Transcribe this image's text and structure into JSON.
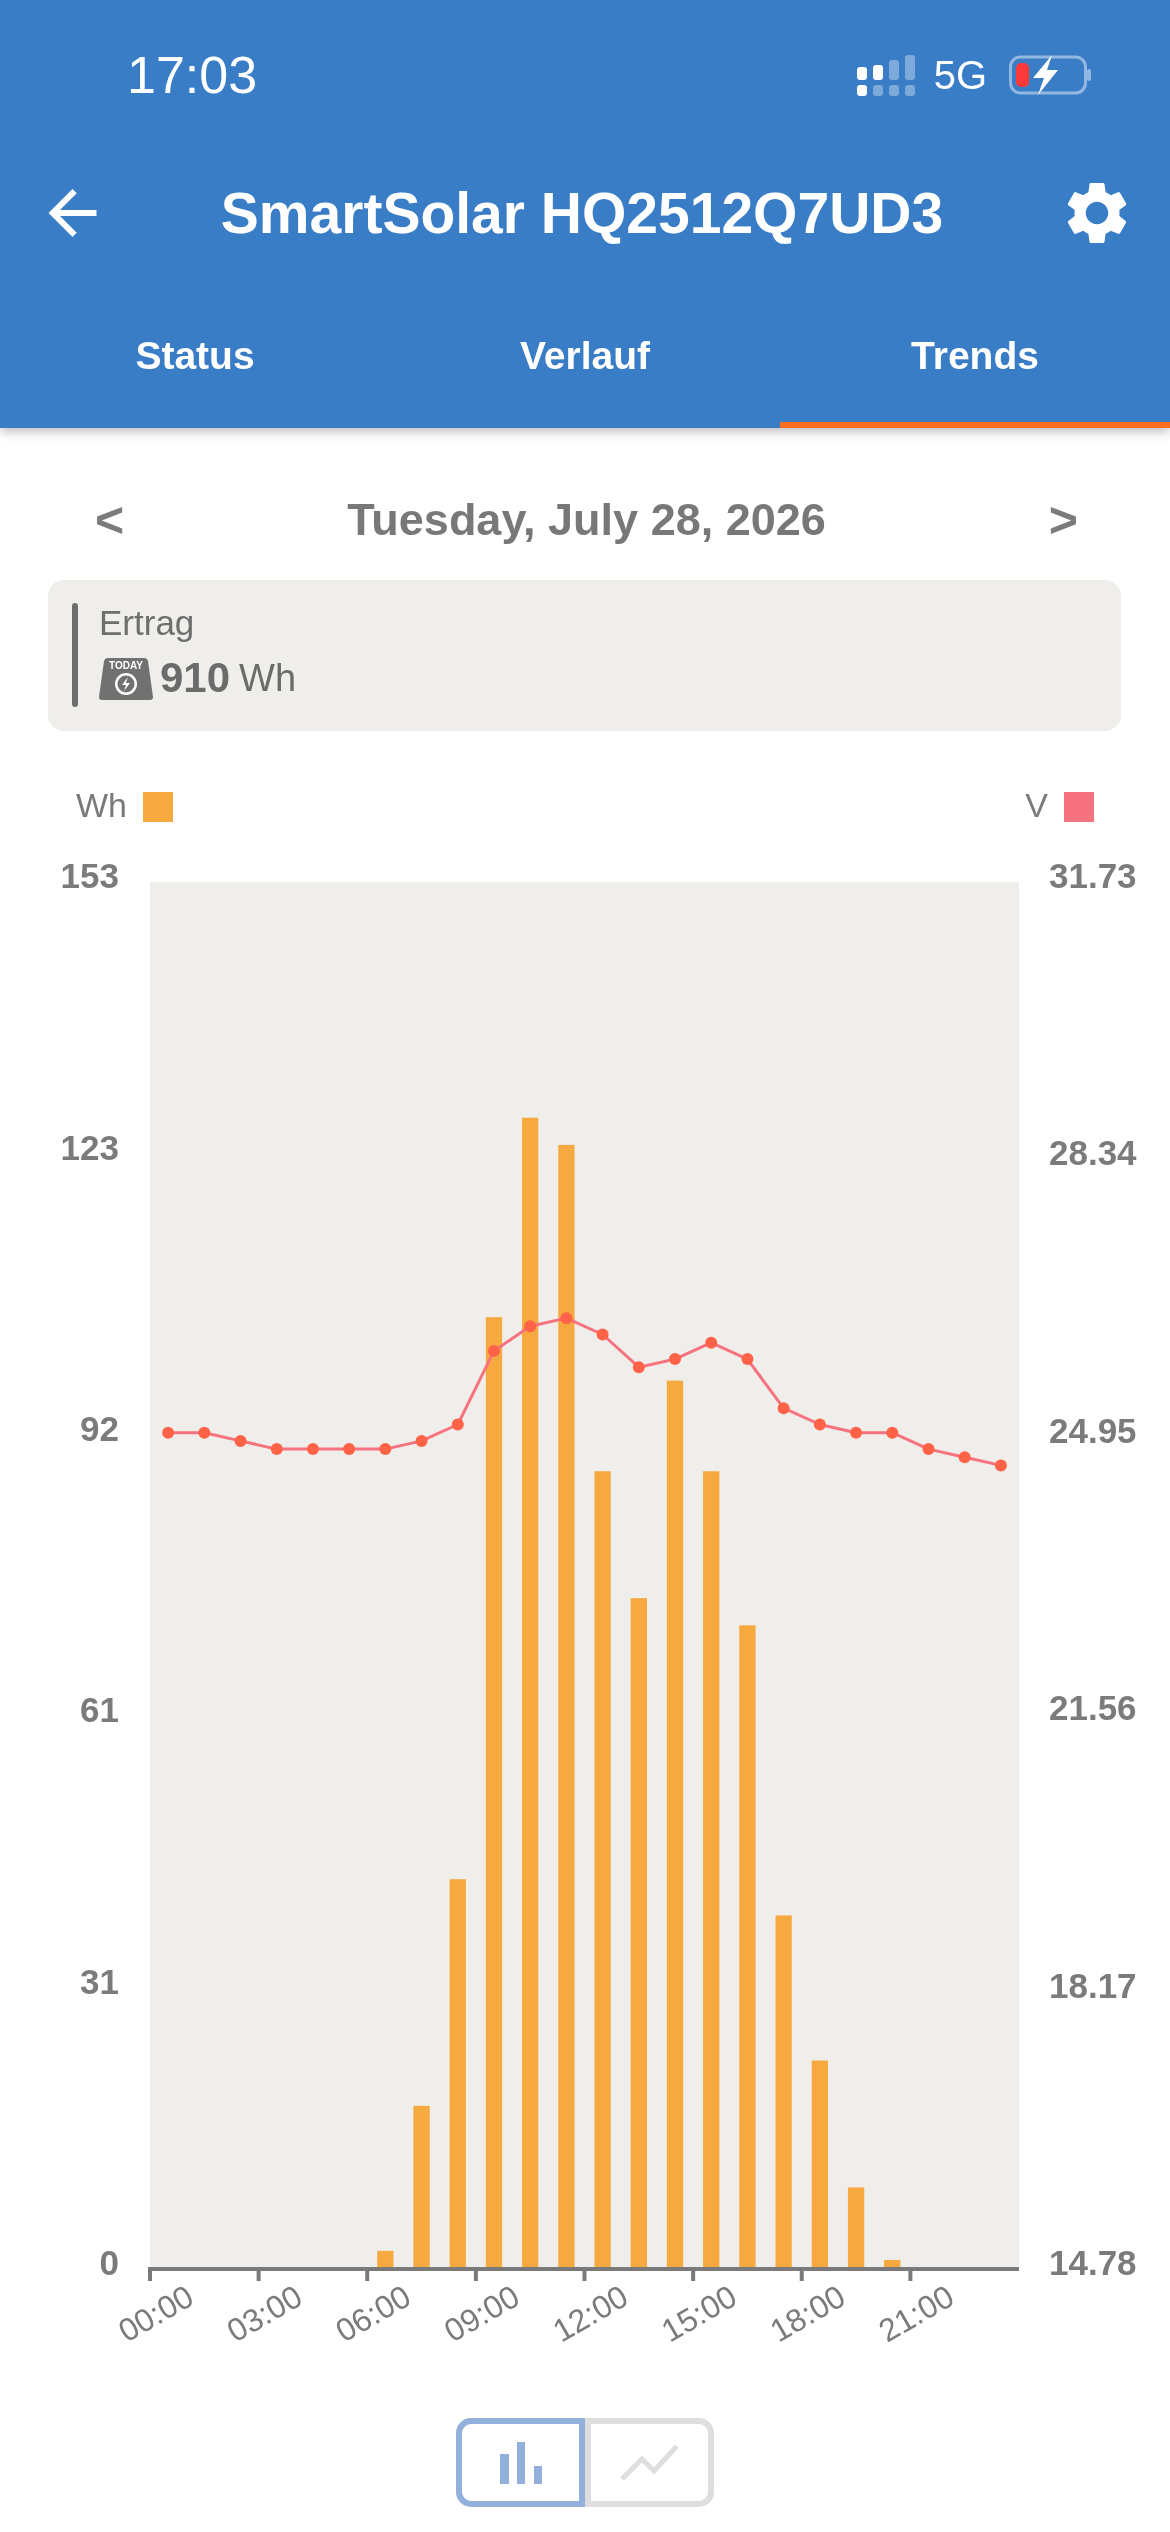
{
  "status_bar": {
    "time": "17:03",
    "network": "5G",
    "charging": true
  },
  "app_bar": {
    "title": "SmartSolar HQ2512Q7UD3"
  },
  "tabs": [
    {
      "label": "Status",
      "selected": false
    },
    {
      "label": "Verlauf",
      "selected": false
    },
    {
      "label": "Trends",
      "selected": true
    }
  ],
  "date_nav": {
    "previous": "<",
    "date": "Tuesday, July 28, 2026",
    "next": ">"
  },
  "yield_card": {
    "label": "Ertrag",
    "icon_text": "TODAY",
    "value": "910",
    "unit": "Wh"
  },
  "chart": {
    "chart_data": {
      "type": "bar",
      "x": [
        0.5,
        1.5,
        2.5,
        3.5,
        4.5,
        5.5,
        6.5,
        7.5,
        8.5,
        9.5,
        10.5,
        11.5,
        12.5,
        13.5,
        14.5,
        15.5,
        16.5,
        17.5,
        18.5,
        19.5,
        20.5,
        21.5,
        22.5,
        23.5
      ],
      "xlim": [
        0,
        24
      ],
      "xticks": [
        {
          "value": 0,
          "label": "00:00"
        },
        {
          "value": 3,
          "label": "03:00"
        },
        {
          "value": 6,
          "label": "06:00"
        },
        {
          "value": 9,
          "label": "09:00"
        },
        {
          "value": 12,
          "label": "12:00"
        },
        {
          "value": 15,
          "label": "15:00"
        },
        {
          "value": 18,
          "label": "18:00"
        },
        {
          "value": 21,
          "label": "21:00"
        }
      ],
      "ylim": [
        0,
        153
      ],
      "yticks": [
        0,
        31,
        61,
        92,
        123,
        153
      ],
      "y2lim": [
        14.78,
        31.73
      ],
      "y2ticks": [
        14.78,
        18.17,
        21.56,
        24.95,
        28.34,
        31.73
      ],
      "series": [
        {
          "name": "Wh",
          "color": "#f6a93f",
          "values": [
            0,
            0,
            0,
            0,
            0,
            0,
            2,
            18,
            43,
            105,
            127,
            124,
            88,
            74,
            98,
            88,
            71,
            39,
            23,
            9,
            1,
            0,
            0,
            0
          ]
        },
        {
          "name": "V",
          "color": "#f7727f",
          "type": "line",
          "axis": "y2",
          "marker": true,
          "values": [
            25.0,
            25.0,
            24.9,
            24.8,
            24.8,
            24.8,
            24.8,
            24.9,
            25.1,
            26.0,
            26.3,
            26.4,
            26.2,
            25.8,
            25.9,
            26.1,
            25.9,
            25.3,
            25.1,
            25.0,
            25.0,
            24.8,
            24.7,
            24.6
          ]
        }
      ]
    }
  },
  "chart_toggle": [
    {
      "kind": "bar",
      "selected": true
    },
    {
      "kind": "line",
      "selected": false
    }
  ]
}
